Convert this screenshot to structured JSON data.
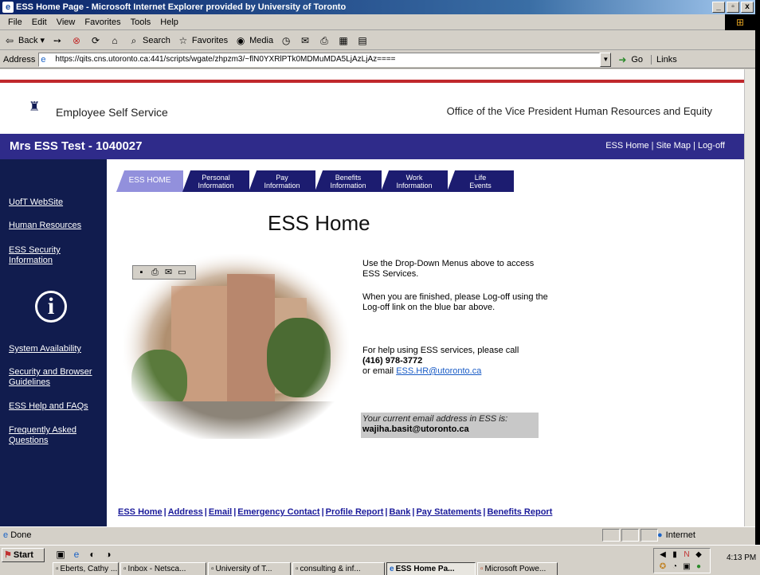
{
  "window": {
    "title": "ESS Home Page - Microsoft Internet Explorer provided by University of Toronto",
    "controls": [
      "_",
      "▫",
      "x"
    ]
  },
  "menu": [
    "File",
    "Edit",
    "View",
    "Favorites",
    "Tools",
    "Help"
  ],
  "toolbar": {
    "back": "Back",
    "search": "Search",
    "favorites": "Favorites",
    "media": "Media"
  },
  "address": {
    "label": "Address",
    "url": "https://qits.cns.utoronto.ca:441/scripts/wgate/zhpzm3/~flN0YXRlPTk0MDMuMDA5LjAzLjAz====",
    "go": "Go",
    "links": "Links"
  },
  "header": {
    "site_title": "Employee Self Service",
    "office": "Office of the Vice President Human Resources and Equity"
  },
  "bluebar": {
    "user": "Mrs ESS Test - 1040027",
    "nav": "ESS Home | Site Map | Log-off"
  },
  "leftnav": [
    "UofT WebSite",
    "Human Resources",
    "ESS Security Information",
    "System Availability",
    "Security and Browser Guidelines",
    "ESS Help and FAQs",
    "Frequently Asked Questions"
  ],
  "tabs": [
    {
      "line1": "ESS HOME",
      "line2": ""
    },
    {
      "line1": "Personal",
      "line2": "Information"
    },
    {
      "line1": "Pay",
      "line2": "Information"
    },
    {
      "line1": "Benefits",
      "line2": "Information"
    },
    {
      "line1": "Work",
      "line2": "Information"
    },
    {
      "line1": "Life",
      "line2": "Events"
    }
  ],
  "main": {
    "heading": "ESS Home",
    "p1": "Use the Drop-Down Menus above to access ESS Services.",
    "p2": "When you are finished, please Log-off using the Log-off link on the blue bar above.",
    "p3": "For help using ESS services, please call",
    "phone": "(416) 978-3772",
    "p4": "or email",
    "help_email": "ESS.HR@utoronto.ca",
    "email_label": "Your current email address in ESS is:",
    "current_email": "wajiha.basit@utoronto.ca"
  },
  "footer_links": [
    "ESS Home",
    "Address",
    "Email",
    "Emergency Contact",
    "Profile Report",
    "Bank",
    "Pay Statements",
    "Benefits Report"
  ],
  "status": {
    "left": "Done",
    "zone": "Internet"
  },
  "taskbar": {
    "start": "Start",
    "buttons": [
      "Eberts, Cathy ...",
      "Inbox - Netsca...",
      "University of T...",
      "consulting & inf...",
      "ESS Home Pa...",
      "Microsoft Powe..."
    ],
    "active_index": 4,
    "clock": "4:13 PM"
  }
}
